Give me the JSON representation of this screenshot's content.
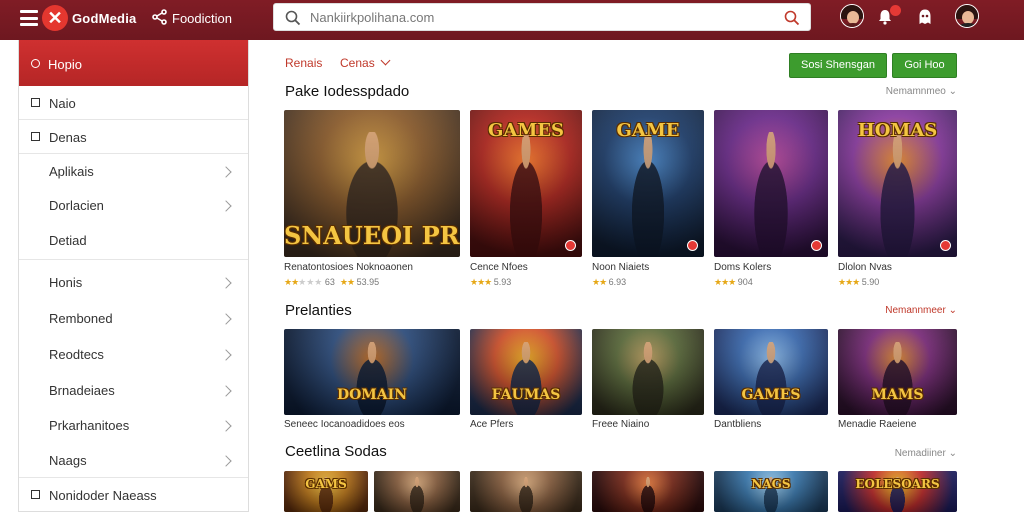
{
  "app": {
    "brand": "GodMedia",
    "nav_label": "Foodiction"
  },
  "search": {
    "placeholder": "Nankiirkpolihana.com"
  },
  "sidebar": {
    "active": "Hopio",
    "items": [
      {
        "label": "Naio",
        "checkbox": true
      },
      {
        "label": "Denas",
        "checkbox": true
      },
      {
        "label": "Aplikais",
        "chevron": true
      },
      {
        "label": "Dorlacien",
        "chevron": true
      },
      {
        "label": "Detiad",
        "chevron": false
      },
      {
        "label": "Honis",
        "chevron": true
      },
      {
        "label": "Remboned",
        "chevron": true
      },
      {
        "label": "Reodtecs",
        "chevron": true
      },
      {
        "label": "Brnadeiaes",
        "chevron": true
      },
      {
        "label": "Prkarhanitoes",
        "chevron": true
      },
      {
        "label": "Naags",
        "chevron": true
      },
      {
        "label": "Nonidoder Naeass",
        "checkbox": true
      }
    ]
  },
  "filters": {
    "first": "Renais",
    "second": "Cenas"
  },
  "buttons": {
    "primary": "Sosi Shensgan",
    "secondary": "Goi Hoo"
  },
  "sections": [
    {
      "title": "Pake Iodesspdado",
      "view_all": "Nemamnmeo",
      "cards": [
        {
          "title": "Renatontosioes Noknoaonen",
          "rating": "63",
          "rating2": "53.95",
          "art_text": "SNAUEOI PRS",
          "palette": [
            "#3a2a1e",
            "#8a5a2a",
            "#d8a040"
          ],
          "stars": 2
        },
        {
          "title": "Cence Nfoes",
          "rating": "5.93",
          "art_text": "GAMES",
          "palette": [
            "#4a0d0d",
            "#b3261e",
            "#ff7b2a"
          ],
          "stars": 3
        },
        {
          "title": "Noon Niaiets",
          "rating": "6.93",
          "art_text": "GAME",
          "palette": [
            "#0d1a2e",
            "#1d3d6b",
            "#4a8bd0"
          ],
          "stars": 2
        },
        {
          "title": "Doms Kolers",
          "rating": "904",
          "art_text": "",
          "palette": [
            "#2a0f3a",
            "#6a2a8a",
            "#c04aa0"
          ],
          "stars": 3
        },
        {
          "title": "Dlolon Nvas",
          "rating": "5.90",
          "art_text": "HOMAS",
          "palette": [
            "#2a1a4a",
            "#8a3aa0",
            "#f09030"
          ],
          "stars": 3
        }
      ]
    },
    {
      "title": "Prelanties",
      "view_all": "Nemannmeer",
      "cards": [
        {
          "title": "Seneec Iocanoadidoes eos",
          "art_text": "DOMAIN",
          "palette": [
            "#0b1a33",
            "#2a4a7a",
            "#c06a20"
          ]
        },
        {
          "title": "Ace Pfers",
          "art_text": "FAUMAS",
          "palette": [
            "#1a2a4a",
            "#d0502a",
            "#f0b020"
          ]
        },
        {
          "title": "Freee Niaino",
          "art_text": "",
          "palette": [
            "#2a2a1a",
            "#5a6a3a",
            "#c0a060"
          ]
        },
        {
          "title": "Dantbliens",
          "art_text": "GAMES",
          "palette": [
            "#1a2a5a",
            "#3a6ab0",
            "#90c0f0"
          ]
        },
        {
          "title": "Menadie Raeiene",
          "art_text": "MAMS",
          "palette": [
            "#2a0f2a",
            "#7a2a7a",
            "#e08a30"
          ]
        }
      ]
    },
    {
      "title": "Ceetlina Sodas",
      "view_all": "Nemadiiner",
      "cards": [
        {
          "title": "",
          "art_text": "GAMS",
          "palette": [
            "#5a2a0a",
            "#c07a1a",
            "#f0c040"
          ]
        },
        {
          "title": "",
          "art_text": "",
          "palette": [
            "#3a2a1a",
            "#8a6040",
            "#e0b080"
          ]
        },
        {
          "title": "",
          "art_text": "",
          "palette": [
            "#2a0a0a",
            "#7a2a1a",
            "#f08040"
          ]
        },
        {
          "title": "",
          "art_text": "NAGS",
          "palette": [
            "#1a3a5a",
            "#3a7ab0",
            "#a0d0f0"
          ]
        },
        {
          "title": "",
          "art_text": "EOLESOARS",
          "palette": [
            "#1a1a5a",
            "#c02a2a",
            "#f0c020"
          ]
        }
      ]
    }
  ]
}
